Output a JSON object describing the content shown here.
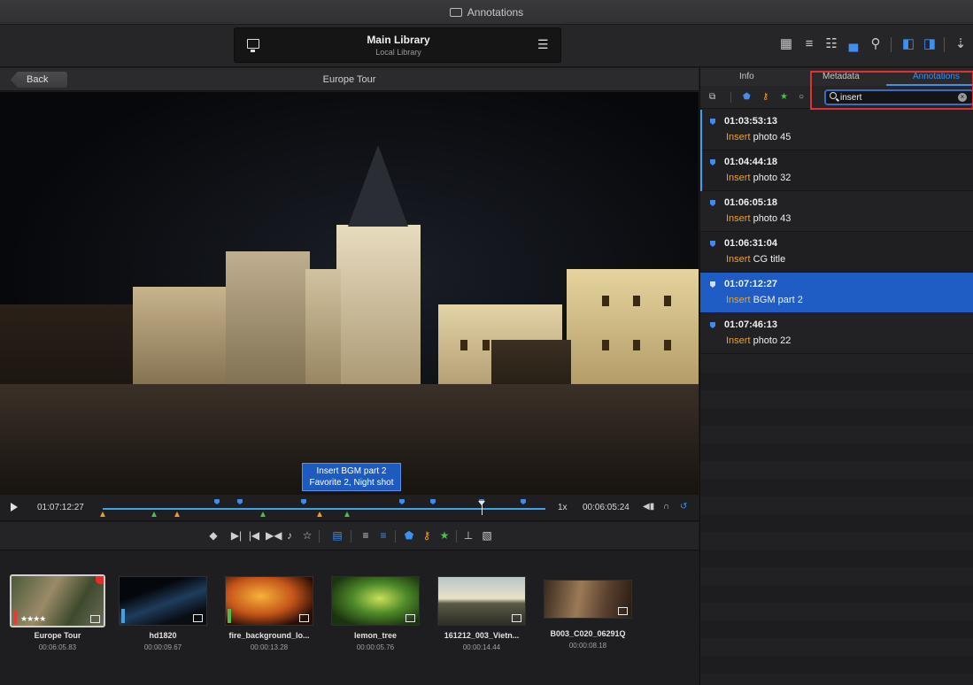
{
  "window": {
    "title": "Annotations"
  },
  "library": {
    "title": "Main Library",
    "subtitle": "Local Library"
  },
  "viewer": {
    "back_label": "Back",
    "title": "Europe Tour",
    "caption_line1": "Insert BGM part 2",
    "caption_line2": "Favorite 2, Night shot"
  },
  "timeline": {
    "current_tc": "01:07:12:27",
    "speed": "1x",
    "duration_tc": "00:06:05:24"
  },
  "panel": {
    "tabs": [
      "Info",
      "Metadata",
      "Annotations"
    ],
    "active_tab": "Annotations",
    "search_value": "insert",
    "annotations": [
      {
        "tc": "01:03:53:13",
        "highlight": "Insert",
        "rest": " photo 45"
      },
      {
        "tc": "01:04:44:18",
        "highlight": "Insert",
        "rest": " photo 32"
      },
      {
        "tc": "01:06:05:18",
        "highlight": "Insert",
        "rest": " photo 43"
      },
      {
        "tc": "01:06:31:04",
        "highlight": "Insert",
        "rest": " CG title"
      },
      {
        "tc": "01:07:12:27",
        "highlight": "Insert",
        "rest": " BGM part 2"
      },
      {
        "tc": "01:07:46:13",
        "highlight": "Insert",
        "rest": " photo 22"
      }
    ]
  },
  "bin": {
    "clips": [
      {
        "name": "Europe Tour",
        "duration": "00:06:05.83",
        "stars": "★★★★"
      },
      {
        "name": "hd1820",
        "duration": "00:00:09.67"
      },
      {
        "name": "fire_background_lo...",
        "duration": "00:00:13.28"
      },
      {
        "name": "lemon_tree",
        "duration": "00:00:05.76"
      },
      {
        "name": "161212_003_Vietn...",
        "duration": "00:00:14.44"
      },
      {
        "name": "B003_C020_06291Q",
        "duration": "00:00:08.18"
      }
    ]
  },
  "colors": {
    "accent": "#3d8ff0",
    "highlight": "#f0a11f",
    "selected_row": "#1f5cc4",
    "search_outline": "#e0302f"
  }
}
